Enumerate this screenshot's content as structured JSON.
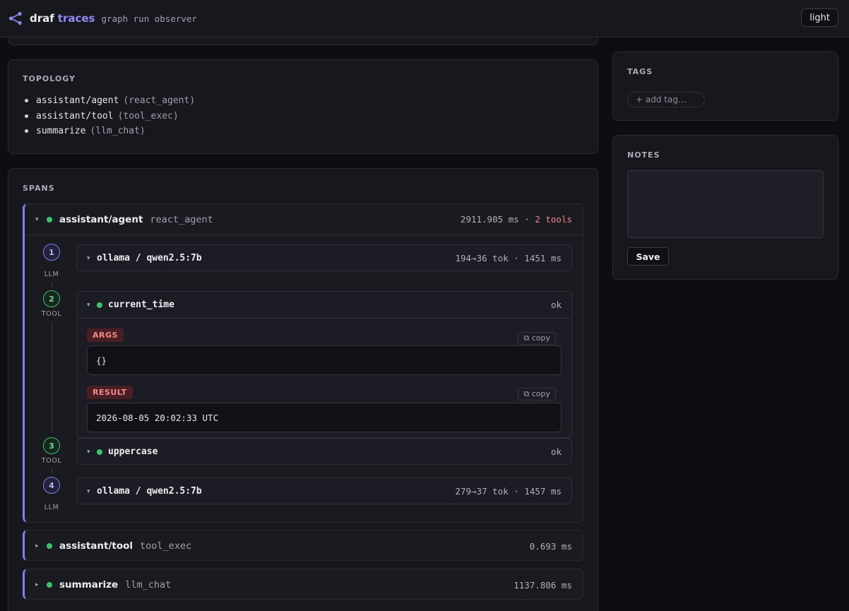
{
  "header": {
    "brand_primary": "draf",
    "brand_secondary": "traces",
    "subtitle": "graph run observer",
    "theme_toggle": "light"
  },
  "topology": {
    "title": "TOPOLOGY",
    "items": [
      {
        "name": "assistant/agent",
        "type": "(react_agent)"
      },
      {
        "name": "assistant/tool",
        "type": "(tool_exec)"
      },
      {
        "name": "summarize",
        "type": "(llm_chat)"
      }
    ]
  },
  "spans": {
    "title": "SPANS",
    "agent": {
      "name": "assistant/agent",
      "type": "react_agent",
      "duration": "2911.905 ms",
      "separator": "·",
      "tools": "2 tools",
      "steps": [
        {
          "num": "1",
          "kind": "LLM",
          "title": "ollama / qwen2.5:7b",
          "meta": "194→36 tok · 1451 ms"
        },
        {
          "num": "2",
          "kind": "TOOL",
          "title": "current_time",
          "meta": "ok",
          "args_label": "ARGS",
          "args_value": "{}",
          "result_label": "RESULT",
          "result_value": "2026-08-05 20:02:33 UTC",
          "copy_label": "⧉ copy"
        },
        {
          "num": "3",
          "kind": "TOOL",
          "title": "uppercase",
          "meta": "ok"
        },
        {
          "num": "4",
          "kind": "LLM",
          "title": "ollama / qwen2.5:7b",
          "meta": "279→37 tok · 1457 ms"
        }
      ]
    },
    "tool_span": {
      "name": "assistant/tool",
      "type": "tool_exec",
      "duration": "0.693 ms"
    },
    "summarize_span": {
      "name": "summarize",
      "type": "llm_chat",
      "duration": "1137.806 ms"
    }
  },
  "tags": {
    "title": "TAGS",
    "add_placeholder": "+ add tag…"
  },
  "notes": {
    "title": "NOTES",
    "value": "",
    "save_label": "Save"
  },
  "colors": {
    "accent": "#7f7ff0",
    "ok": "#3cc26b",
    "danger": "#f08585"
  }
}
